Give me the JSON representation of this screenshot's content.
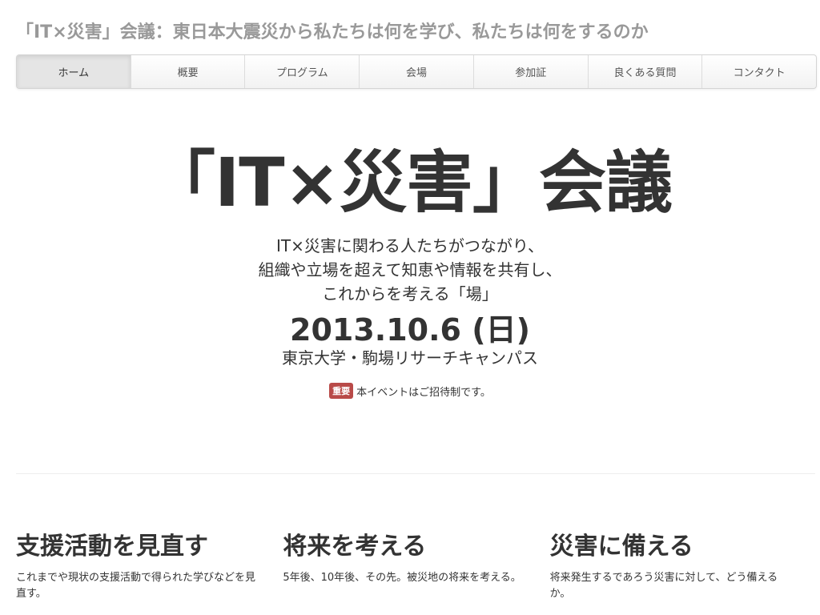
{
  "site": {
    "title": "「IT×災害」会議：東日本大震災から私たちは何を学び、私たちは何をするのか"
  },
  "nav": {
    "items": [
      {
        "label": "ホーム",
        "active": true
      },
      {
        "label": "概要"
      },
      {
        "label": "プログラム"
      },
      {
        "label": "会場"
      },
      {
        "label": "参加証"
      },
      {
        "label": "良くある質問"
      },
      {
        "label": "コンタクト"
      }
    ]
  },
  "hero": {
    "title": "「IT×災害」会議",
    "tagline": [
      "IT×災害に関わる人たちがつながり、",
      "組織や立場を超えて知恵や情報を共有し、",
      "これからを考える「場」"
    ],
    "date": "2013.10.6 (日)",
    "venue": "東京大学・駒場リサーチキャンパス",
    "notice_badge": "重要",
    "notice_text": "本イベントはご招待制です。"
  },
  "features": [
    {
      "heading": "支援活動を見直す",
      "text": "これまでや現状の支援活動で得られた学びなどを見直す。"
    },
    {
      "heading": "将来を考える",
      "text": "5年後、10年後、その先。被災地の将来を考える。"
    },
    {
      "heading": "災害に備える",
      "text": "将来発生するであろう災害に対して、どう備えるか。"
    }
  ],
  "colors": {
    "badge": "#b94a48",
    "site_title": "#999999",
    "text": "#333333"
  }
}
